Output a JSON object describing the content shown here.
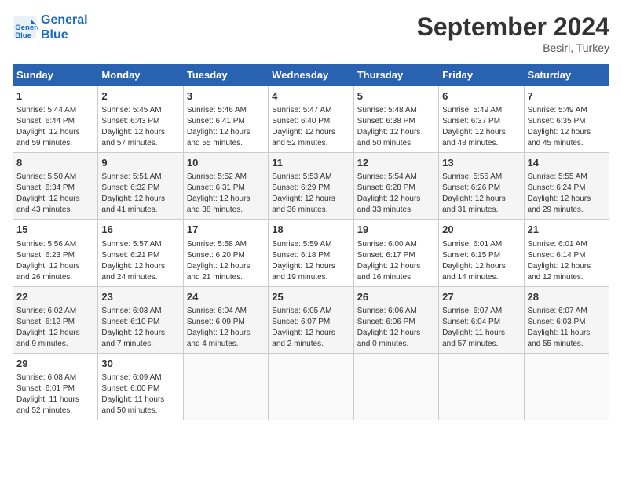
{
  "header": {
    "logo_line1": "General",
    "logo_line2": "Blue",
    "month": "September 2024",
    "location": "Besiri, Turkey"
  },
  "days_of_week": [
    "Sunday",
    "Monday",
    "Tuesday",
    "Wednesday",
    "Thursday",
    "Friday",
    "Saturday"
  ],
  "weeks": [
    [
      {
        "day": "1",
        "info": "Sunrise: 5:44 AM\nSunset: 6:44 PM\nDaylight: 12 hours\nand 59 minutes."
      },
      {
        "day": "2",
        "info": "Sunrise: 5:45 AM\nSunset: 6:43 PM\nDaylight: 12 hours\nand 57 minutes."
      },
      {
        "day": "3",
        "info": "Sunrise: 5:46 AM\nSunset: 6:41 PM\nDaylight: 12 hours\nand 55 minutes."
      },
      {
        "day": "4",
        "info": "Sunrise: 5:47 AM\nSunset: 6:40 PM\nDaylight: 12 hours\nand 52 minutes."
      },
      {
        "day": "5",
        "info": "Sunrise: 5:48 AM\nSunset: 6:38 PM\nDaylight: 12 hours\nand 50 minutes."
      },
      {
        "day": "6",
        "info": "Sunrise: 5:49 AM\nSunset: 6:37 PM\nDaylight: 12 hours\nand 48 minutes."
      },
      {
        "day": "7",
        "info": "Sunrise: 5:49 AM\nSunset: 6:35 PM\nDaylight: 12 hours\nand 45 minutes."
      }
    ],
    [
      {
        "day": "8",
        "info": "Sunrise: 5:50 AM\nSunset: 6:34 PM\nDaylight: 12 hours\nand 43 minutes."
      },
      {
        "day": "9",
        "info": "Sunrise: 5:51 AM\nSunset: 6:32 PM\nDaylight: 12 hours\nand 41 minutes."
      },
      {
        "day": "10",
        "info": "Sunrise: 5:52 AM\nSunset: 6:31 PM\nDaylight: 12 hours\nand 38 minutes."
      },
      {
        "day": "11",
        "info": "Sunrise: 5:53 AM\nSunset: 6:29 PM\nDaylight: 12 hours\nand 36 minutes."
      },
      {
        "day": "12",
        "info": "Sunrise: 5:54 AM\nSunset: 6:28 PM\nDaylight: 12 hours\nand 33 minutes."
      },
      {
        "day": "13",
        "info": "Sunrise: 5:55 AM\nSunset: 6:26 PM\nDaylight: 12 hours\nand 31 minutes."
      },
      {
        "day": "14",
        "info": "Sunrise: 5:55 AM\nSunset: 6:24 PM\nDaylight: 12 hours\nand 29 minutes."
      }
    ],
    [
      {
        "day": "15",
        "info": "Sunrise: 5:56 AM\nSunset: 6:23 PM\nDaylight: 12 hours\nand 26 minutes."
      },
      {
        "day": "16",
        "info": "Sunrise: 5:57 AM\nSunset: 6:21 PM\nDaylight: 12 hours\nand 24 minutes."
      },
      {
        "day": "17",
        "info": "Sunrise: 5:58 AM\nSunset: 6:20 PM\nDaylight: 12 hours\nand 21 minutes."
      },
      {
        "day": "18",
        "info": "Sunrise: 5:59 AM\nSunset: 6:18 PM\nDaylight: 12 hours\nand 19 minutes."
      },
      {
        "day": "19",
        "info": "Sunrise: 6:00 AM\nSunset: 6:17 PM\nDaylight: 12 hours\nand 16 minutes."
      },
      {
        "day": "20",
        "info": "Sunrise: 6:01 AM\nSunset: 6:15 PM\nDaylight: 12 hours\nand 14 minutes."
      },
      {
        "day": "21",
        "info": "Sunrise: 6:01 AM\nSunset: 6:14 PM\nDaylight: 12 hours\nand 12 minutes."
      }
    ],
    [
      {
        "day": "22",
        "info": "Sunrise: 6:02 AM\nSunset: 6:12 PM\nDaylight: 12 hours\nand 9 minutes."
      },
      {
        "day": "23",
        "info": "Sunrise: 6:03 AM\nSunset: 6:10 PM\nDaylight: 12 hours\nand 7 minutes."
      },
      {
        "day": "24",
        "info": "Sunrise: 6:04 AM\nSunset: 6:09 PM\nDaylight: 12 hours\nand 4 minutes."
      },
      {
        "day": "25",
        "info": "Sunrise: 6:05 AM\nSunset: 6:07 PM\nDaylight: 12 hours\nand 2 minutes."
      },
      {
        "day": "26",
        "info": "Sunrise: 6:06 AM\nSunset: 6:06 PM\nDaylight: 12 hours\nand 0 minutes."
      },
      {
        "day": "27",
        "info": "Sunrise: 6:07 AM\nSunset: 6:04 PM\nDaylight: 11 hours\nand 57 minutes."
      },
      {
        "day": "28",
        "info": "Sunrise: 6:07 AM\nSunset: 6:03 PM\nDaylight: 11 hours\nand 55 minutes."
      }
    ],
    [
      {
        "day": "29",
        "info": "Sunrise: 6:08 AM\nSunset: 6:01 PM\nDaylight: 11 hours\nand 52 minutes."
      },
      {
        "day": "30",
        "info": "Sunrise: 6:09 AM\nSunset: 6:00 PM\nDaylight: 11 hours\nand 50 minutes."
      },
      {
        "day": "",
        "info": ""
      },
      {
        "day": "",
        "info": ""
      },
      {
        "day": "",
        "info": ""
      },
      {
        "day": "",
        "info": ""
      },
      {
        "day": "",
        "info": ""
      }
    ]
  ]
}
